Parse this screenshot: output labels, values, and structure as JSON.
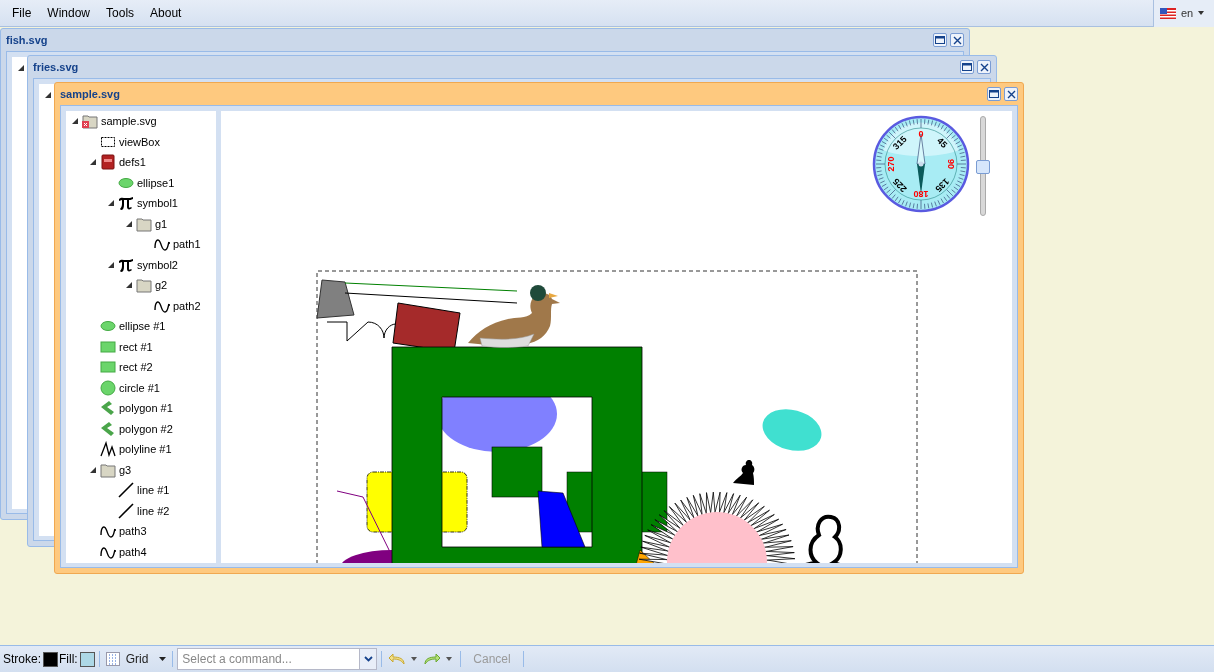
{
  "menu": [
    "File",
    "Window",
    "Tools",
    "About"
  ],
  "language": {
    "label": "en"
  },
  "windows": [
    {
      "title": "fish.svg",
      "active": false
    },
    {
      "title": "fries.svg",
      "active": false
    },
    {
      "title": "sample.svg",
      "active": true,
      "tree": [
        {
          "label": "sample.svg",
          "kind": "document",
          "expanded": true,
          "children": [
            {
              "label": "viewBox",
              "kind": "viewbox"
            },
            {
              "label": "defs1",
              "kind": "defs",
              "expanded": true,
              "children": [
                {
                  "label": "ellipse1",
                  "kind": "ellipse"
                },
                {
                  "label": "symbol1",
                  "kind": "symbol",
                  "expanded": true,
                  "children": [
                    {
                      "label": "g1",
                      "kind": "folder",
                      "expanded": true,
                      "children": [
                        {
                          "label": "path1",
                          "kind": "path"
                        }
                      ]
                    }
                  ]
                },
                {
                  "label": "symbol2",
                  "kind": "symbol",
                  "expanded": true,
                  "children": [
                    {
                      "label": "g2",
                      "kind": "folder",
                      "expanded": true,
                      "children": [
                        {
                          "label": "path2",
                          "kind": "path"
                        }
                      ]
                    }
                  ]
                }
              ]
            },
            {
              "label": "ellipse #1",
              "kind": "ellipse"
            },
            {
              "label": "rect #1",
              "kind": "rect"
            },
            {
              "label": "rect #2",
              "kind": "rect"
            },
            {
              "label": "circle #1",
              "kind": "circle"
            },
            {
              "label": "polygon #1",
              "kind": "polygon"
            },
            {
              "label": "polygon #2",
              "kind": "polygon"
            },
            {
              "label": "polyline #1",
              "kind": "polyline"
            },
            {
              "label": "g3",
              "kind": "folder",
              "expanded": true,
              "children": [
                {
                  "label": "line #1",
                  "kind": "line"
                },
                {
                  "label": "line #2",
                  "kind": "line"
                }
              ]
            },
            {
              "label": "path3",
              "kind": "path"
            },
            {
              "label": "path4",
              "kind": "path"
            }
          ]
        }
      ],
      "compass": {
        "labels": [
          {
            "text": "0",
            "color": "#ff0000"
          },
          {
            "text": "45",
            "color": "#000000"
          },
          {
            "text": "90",
            "color": "#ff0000"
          },
          {
            "text": "135",
            "color": "#000000"
          },
          {
            "text": "180",
            "color": "#ff0000"
          },
          {
            "text": "225",
            "color": "#000000"
          },
          {
            "text": "270",
            "color": "#ff0000"
          },
          {
            "text": "315",
            "color": "#000000"
          }
        ]
      },
      "zoom": {
        "level": 0.5
      }
    }
  ],
  "status_bar": {
    "stroke": {
      "label": "Stroke:",
      "color": "#000000"
    },
    "fill": {
      "label": "Fill:",
      "color": "#add8e6"
    },
    "grid": {
      "label": "Grid"
    },
    "command": {
      "placeholder": "Select a command..."
    },
    "cancel": {
      "label": "Cancel",
      "disabled": true
    }
  }
}
